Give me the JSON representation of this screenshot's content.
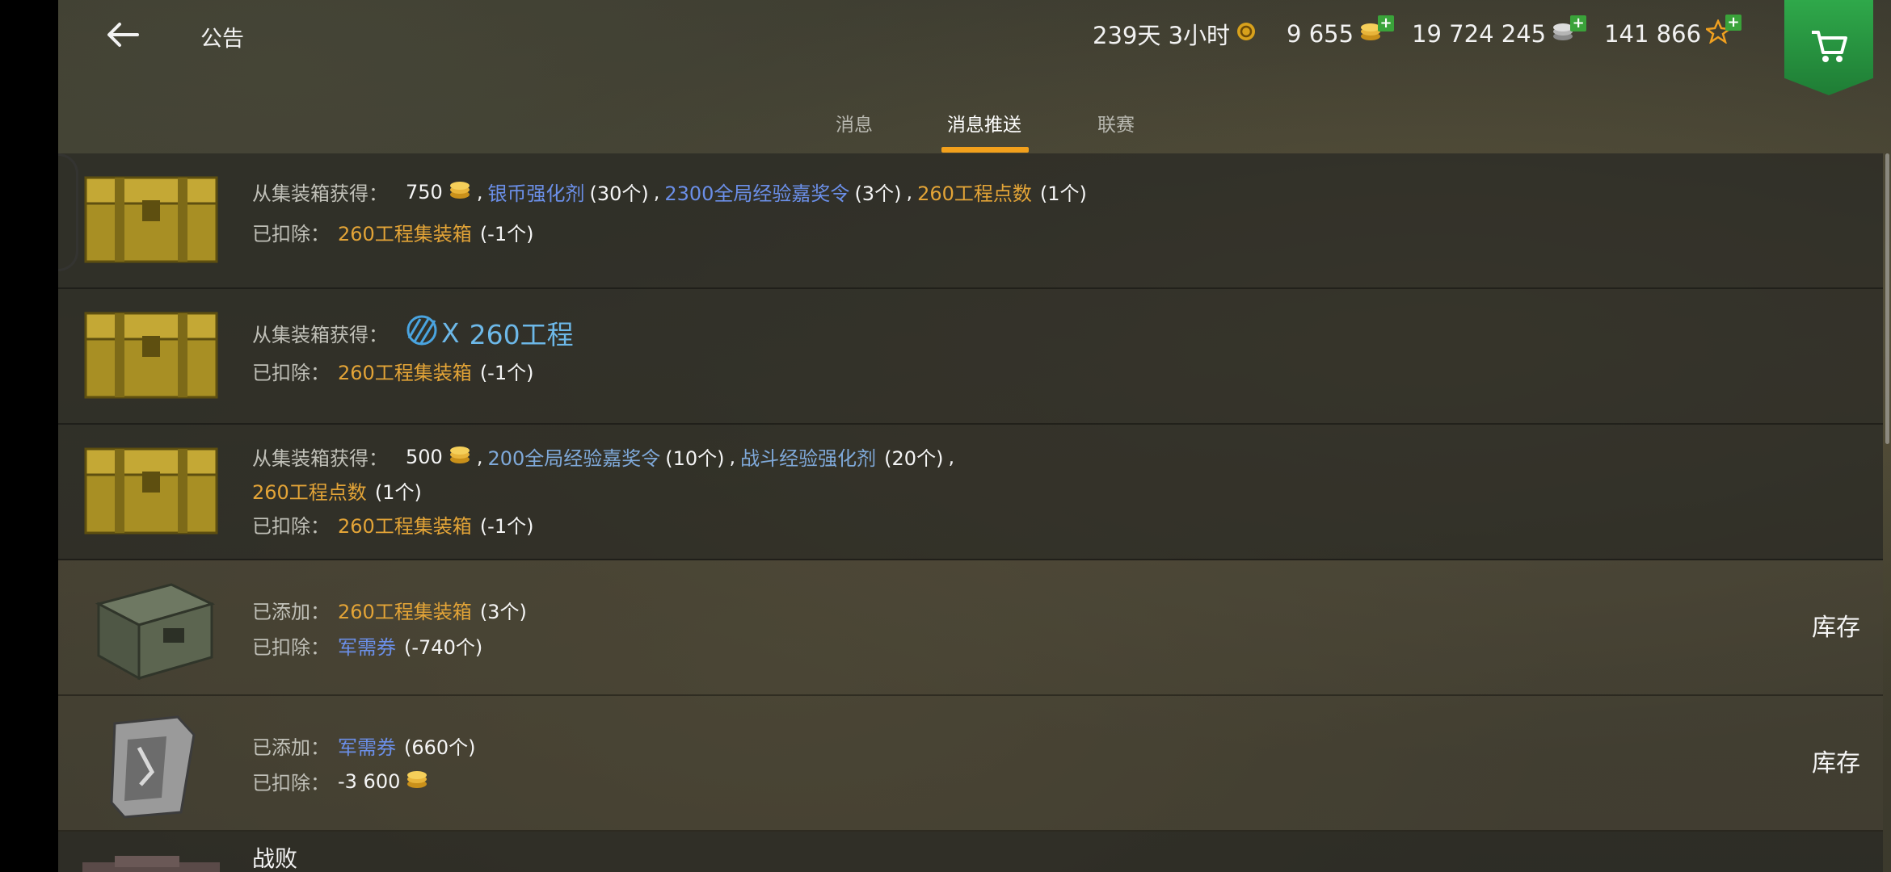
{
  "header": {
    "title": "公告",
    "back_icon": "back-arrow-icon",
    "currencies": [
      {
        "name": "premium-time",
        "value": "239天 3小时",
        "icon": "premium-badge-icon",
        "has_plus": false
      },
      {
        "name": "gold",
        "value": "9 655",
        "icon": "gold-coins-icon",
        "has_plus": true
      },
      {
        "name": "silver",
        "value": "19 724 245",
        "icon": "silver-coins-icon",
        "has_plus": true
      },
      {
        "name": "free-xp",
        "value": "141 866",
        "icon": "free-xp-star-icon",
        "has_plus": true
      }
    ],
    "shop_icon": "shopping-cart-icon"
  },
  "tabs": [
    {
      "label": "消息",
      "active": false
    },
    {
      "label": "消息推送",
      "active": true
    },
    {
      "label": "联赛",
      "active": false
    }
  ],
  "messages": [
    {
      "icon": "golden-container-icon",
      "obtained_label": "从集装箱获得：",
      "gold_amount": "750",
      "item1": "银币强化剂",
      "item1_qty": "(30个)",
      "item2": "2300全局经验嘉奖令",
      "item2_qty": "(3个)",
      "item3": "260工程点数",
      "item3_qty": "(1个)",
      "deducted_label": "已扣除：",
      "deducted_item": "260工程集装箱",
      "deducted_qty": "(-1个)"
    },
    {
      "icon": "golden-container-icon",
      "obtained_label": "从集装箱获得：",
      "tank_tier": "X",
      "tank_name": "260工程",
      "deducted_label": "已扣除：",
      "deducted_item": "260工程集装箱",
      "deducted_qty": "(-1个)"
    },
    {
      "icon": "golden-container-icon",
      "obtained_label": "从集装箱获得：",
      "gold_amount": "500",
      "item1": "200全局经验嘉奖令",
      "item1_qty": "(10个)",
      "item2": "战斗经验强化剂",
      "item2_qty": "(20个)",
      "item3": "260工程点数",
      "item3_qty": "(1个)",
      "deducted_label": "已扣除：",
      "deducted_item": "260工程集装箱",
      "deducted_qty": "(-1个)"
    },
    {
      "icon": "steel-container-icon",
      "added_label": "已添加：",
      "added_item": "260工程集装箱",
      "added_qty": "(3个)",
      "deducted_label": "已扣除：",
      "deducted_item": "军需券",
      "deducted_qty": "(-740个)",
      "action": "库存"
    },
    {
      "icon": "supply-ticket-icon",
      "added_label": "已添加：",
      "added_item": "军需券",
      "added_qty": "(660个)",
      "deducted_label": "已扣除：",
      "deducted_amount": "-3 600",
      "action": "库存"
    },
    {
      "icon": "tank-thumbnail-icon",
      "title": "战败"
    }
  ]
}
